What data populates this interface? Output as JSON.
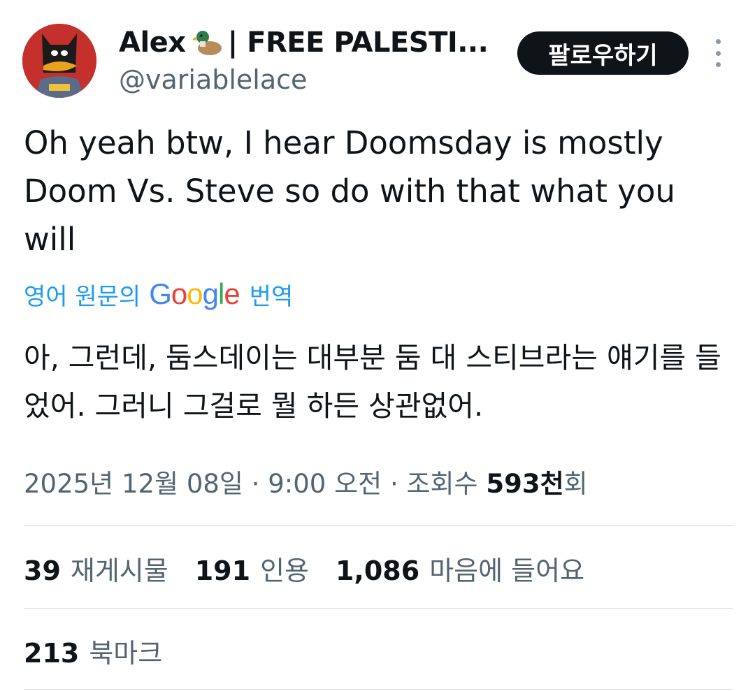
{
  "author": {
    "name": "Alex",
    "name_suffix": "| FREE PALESTI...",
    "handle": "@variablelace",
    "avatar_icon": "batman-duck-avatar",
    "emoji_icon": "duck-emoji-icon"
  },
  "follow_button": {
    "label": "팔로우하기"
  },
  "more_menu": {
    "icon": "more-vertical-icon"
  },
  "tweet": {
    "text": "Oh yeah btw, I hear Doomsday is mostly Doom Vs. Steve so do with that what you will"
  },
  "translation": {
    "prefix": "영어 원문의",
    "google": "Google",
    "suffix": "번역",
    "text": "아, 그런데, 둠스데이는 대부분 둠 대 스티브라는 얘기를 들었어. 그러니 그걸로 뭘 하든 상관없어."
  },
  "meta": {
    "datetime": "2025년 12월 08일 · 9:00 오전 · 조회수 ",
    "views": "593천",
    "views_suffix": "회"
  },
  "stats": {
    "reposts_count": "39",
    "reposts_label": "재게시물",
    "quotes_count": "191",
    "quotes_label": "인용",
    "likes_count": "1,086",
    "likes_label": "마음에 들어요",
    "bookmarks_count": "213",
    "bookmarks_label": "북마크"
  },
  "colors": {
    "link": "#1d9bf0",
    "secondary_text": "#536471",
    "avatar_bg": "#c4302b",
    "button_bg": "#0f1419"
  }
}
